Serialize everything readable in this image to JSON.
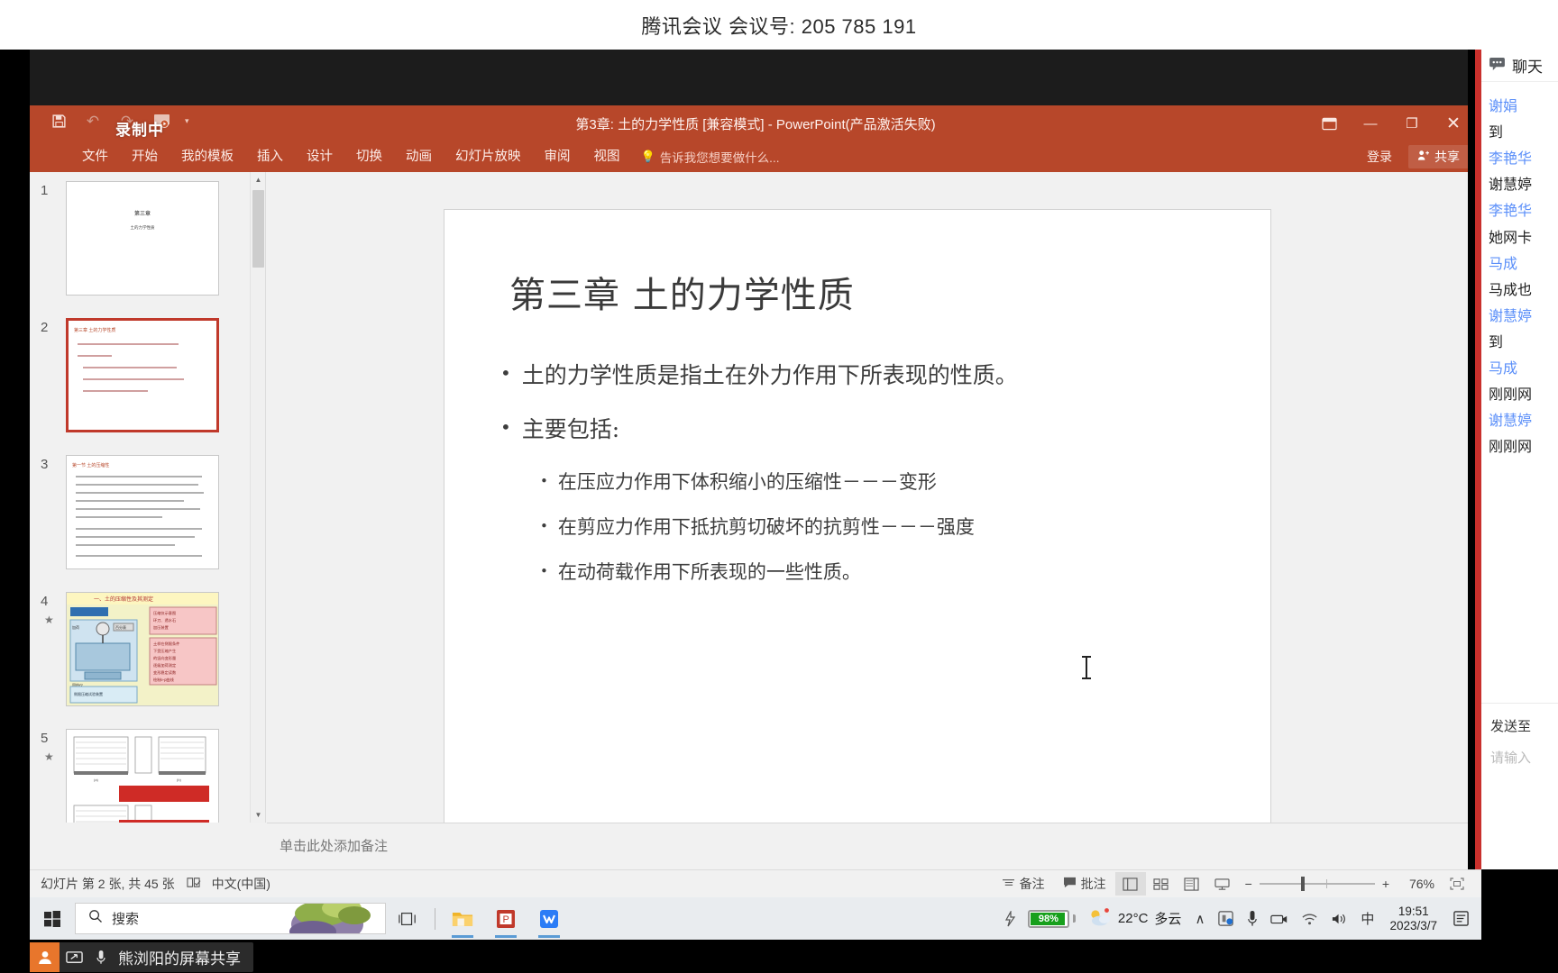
{
  "meeting": {
    "top_title": "腾讯会议 会议号: 205 785 191"
  },
  "powerpoint": {
    "title": "第3章: 土的力学性质 [兼容模式] - PowerPoint(产品激活失败)",
    "recording_badge": "录制中",
    "quick_access": [
      "save-icon",
      "undo-icon",
      "redo-icon",
      "start-slideshow-icon",
      "customize-caret"
    ],
    "tabs": [
      "文件",
      "开始",
      "我的模板",
      "插入",
      "设计",
      "切换",
      "动画",
      "幻灯片放映",
      "审阅",
      "视图"
    ],
    "tell_me": "告诉我您想要做什么...",
    "sign_in": "登录",
    "share": "共享",
    "window_controls": {
      "ribbon_display": "ribbon-display-icon",
      "minimize": "—",
      "restore": "❐",
      "close": "✕"
    },
    "notes_placeholder": "单击此处添加备注",
    "statusbar": {
      "slide_count": "幻灯片 第 2 张, 共 45 张",
      "proof_icon": "spellcheck-icon",
      "language": "中文(中国)",
      "notes_label": "备注",
      "comments_label": "批注",
      "views": [
        "normal-view-icon",
        "slide-sorter-icon",
        "reading-view-icon",
        "slideshow-icon"
      ],
      "zoom_out": "−",
      "zoom_in": "+",
      "zoom_level": "76%",
      "fit_slide": "fit-to-window-icon"
    }
  },
  "slide": {
    "title": "第三章 土的力学性质",
    "bullets": [
      {
        "level": 1,
        "text": "土的力学性质是指土在外力作用下所表现的性质。"
      },
      {
        "level": 1,
        "text": "主要包括:"
      },
      {
        "level": 2,
        "text": "在压应力作用下体积缩小的压缩性－－－变形"
      },
      {
        "level": 2,
        "text": "在剪应力作用下抵抗剪切破坏的抗剪性－－－强度"
      },
      {
        "level": 2,
        "text": "在动荷载作用下所表现的一些性质。"
      }
    ]
  },
  "thumbnails": [
    {
      "number": "1",
      "selected": false,
      "starred": false,
      "kind": "title",
      "title": "第三章",
      "subtitle": "土的力学性质"
    },
    {
      "number": "2",
      "selected": true,
      "starred": false,
      "kind": "bullets",
      "header": "第三章 土的力学性质"
    },
    {
      "number": "3",
      "selected": false,
      "starred": false,
      "kind": "text",
      "header": "第一节 土的压缩性"
    },
    {
      "number": "4",
      "selected": false,
      "starred": true,
      "kind": "diagram",
      "header": "一、土的压缩性及其测定"
    },
    {
      "number": "5",
      "selected": false,
      "starred": true,
      "kind": "figure",
      "header": ""
    }
  ],
  "chat": {
    "header_title": "聊天",
    "header_icon": "chat-bubble-icon",
    "cut_top": "…",
    "messages": [
      {
        "name": "谢娟",
        "text": "到"
      },
      {
        "name": "李艳华",
        "text": "谢慧婷"
      },
      {
        "name": "李艳华",
        "text": "她网卡"
      },
      {
        "name": "马成",
        "text": "马成也"
      },
      {
        "name": "谢慧婷",
        "text": "到"
      },
      {
        "name": "马成",
        "text": "刚刚网"
      },
      {
        "name": "谢慧婷",
        "text": "刚刚网"
      }
    ],
    "send_to_label": "发送至",
    "input_placeholder": "请输入"
  },
  "taskbar": {
    "start_icon": "windows-logo-icon",
    "search_placeholder": "搜索",
    "search_icon": "search-icon",
    "task_view_icon": "task-view-icon",
    "pinned": [
      {
        "name": "file-explorer-icon",
        "running": true
      },
      {
        "name": "powerpoint-icon",
        "running": true
      },
      {
        "name": "tencent-meeting-icon",
        "running": true
      }
    ],
    "tray": {
      "battery_percent": "98%",
      "charging_icon": "charging-bolt-icon",
      "temperature": "22°C",
      "weather_text": "多云",
      "weather_icon": "partly-cloudy-icon",
      "chevron_up": "∧",
      "icons": [
        "security-icon",
        "microphone-icon",
        "camera-icon",
        "wifi-icon",
        "volume-icon"
      ],
      "ime": "中",
      "time": "19:51",
      "date": "2023/3/7",
      "notifications_icon": "notification-icon"
    }
  },
  "sharebar": {
    "avatar_icon": "user-icon",
    "screen_icon": "screen-share-icon",
    "mic_icon": "microphone-icon",
    "label": "熊浏阳的屏幕共享"
  },
  "colors": {
    "ppt_accent": "#b7472a",
    "chat_name": "#5b8ff9",
    "battery_green": "#17a01c",
    "share_avatar": "#e8762c",
    "selection_red": "#c0392b"
  }
}
